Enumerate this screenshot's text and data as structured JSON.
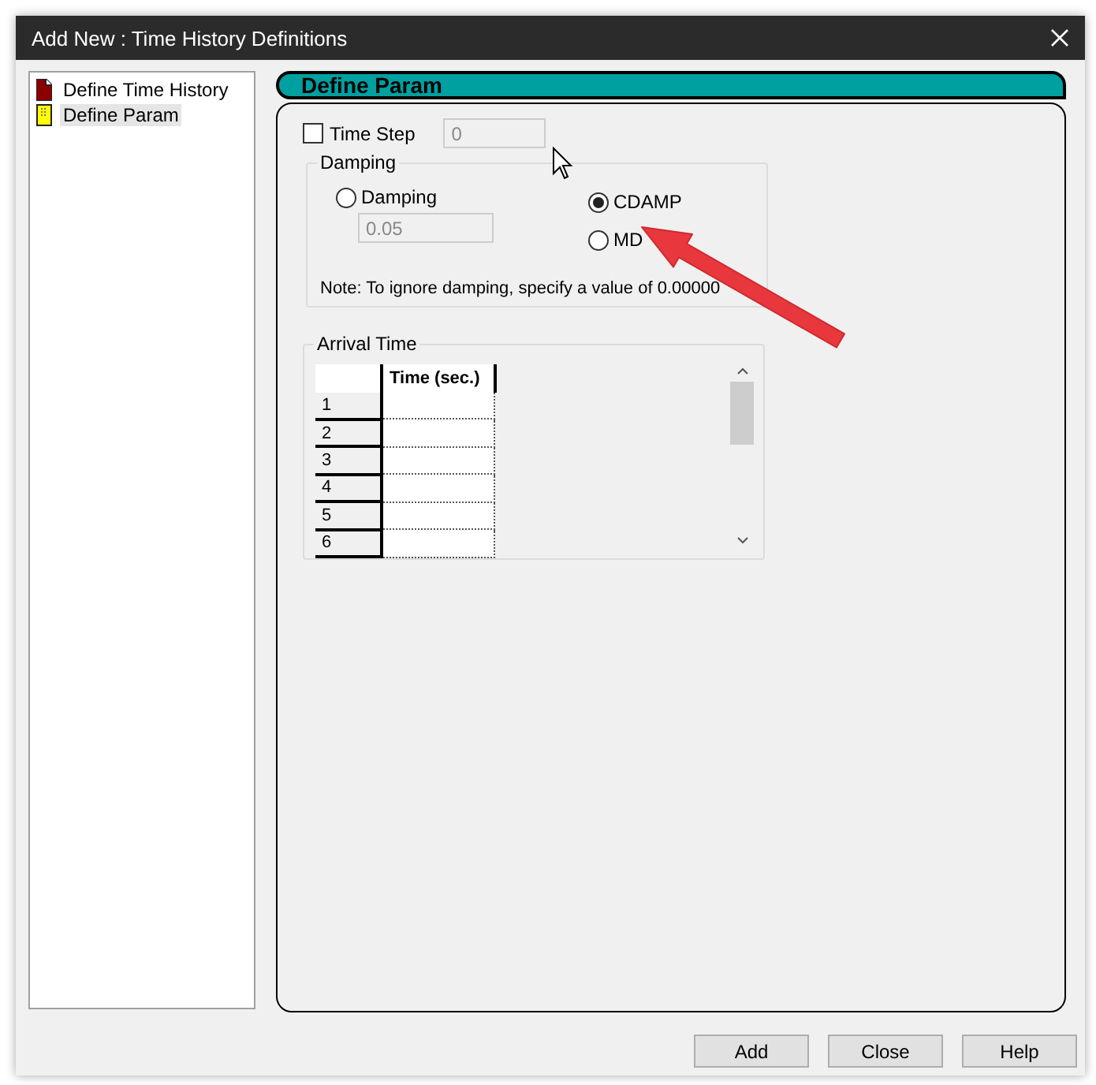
{
  "window": {
    "title": "Add New : Time History Definitions"
  },
  "tree": {
    "items": [
      {
        "label": "Define Time History",
        "kind": "page",
        "selected": false
      },
      {
        "label": "Define Param",
        "kind": "note",
        "selected": true
      }
    ]
  },
  "section": {
    "title": "Define Param"
  },
  "time_step": {
    "label": "Time Step",
    "checked": false,
    "value": "0"
  },
  "damping": {
    "title": "Damping",
    "options": [
      {
        "label": "Damping",
        "selected": false,
        "value": "0.05"
      },
      {
        "label": "CDAMP",
        "selected": true
      },
      {
        "label": "MD",
        "selected": false
      }
    ],
    "note": "Note: To ignore damping, specify a value of 0.00000"
  },
  "arrival_time": {
    "title": "Arrival Time",
    "columns": [
      "Time (sec.)"
    ],
    "rows": [
      "1",
      "2",
      "3",
      "4",
      "5",
      "6"
    ]
  },
  "buttons": [
    "Add",
    "Close",
    "Help"
  ]
}
